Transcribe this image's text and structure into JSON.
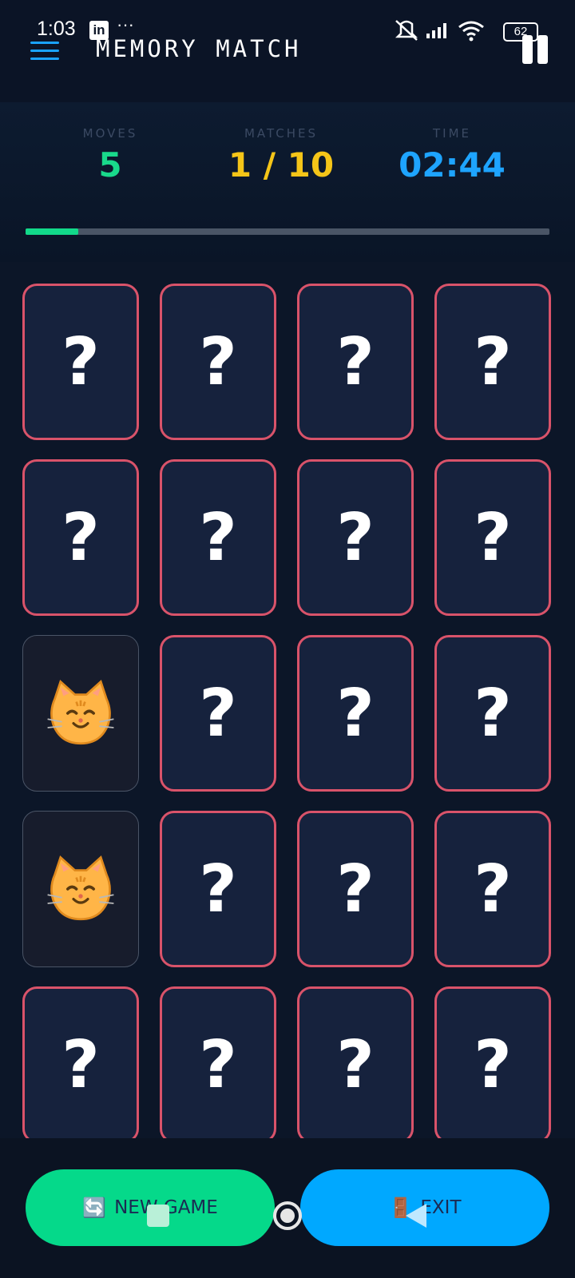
{
  "status_bar": {
    "time": "1:03",
    "app_icon": "linkedin-icon",
    "dots": "···",
    "battery": "62"
  },
  "header": {
    "title": "MEMORY MATCH"
  },
  "stats": {
    "moves": {
      "label": "MOVES",
      "value": "5",
      "color": "#19d98b"
    },
    "matches": {
      "label": "MATCHES",
      "value": "1 / 10",
      "color": "#f5c518"
    },
    "time": {
      "label": "TIME",
      "value": "02:44",
      "color": "#1ea4ff"
    }
  },
  "progress": {
    "fraction": 0.1,
    "color": "#12d98a"
  },
  "board": {
    "columns": 4,
    "hidden_symbol": "?",
    "cards": [
      "?",
      "?",
      "?",
      "?",
      "?",
      "?",
      "?",
      "?",
      "cat",
      "?",
      "?",
      "?",
      "cat",
      "?",
      "?",
      "?",
      "?",
      "?",
      "?",
      "?"
    ]
  },
  "buttons": {
    "new_game": {
      "label": "NEW GAME",
      "icon": "refresh-icon",
      "color": "#05d98a"
    },
    "exit": {
      "label": "EXIT",
      "icon": "door-icon",
      "color": "#00a8ff"
    }
  }
}
